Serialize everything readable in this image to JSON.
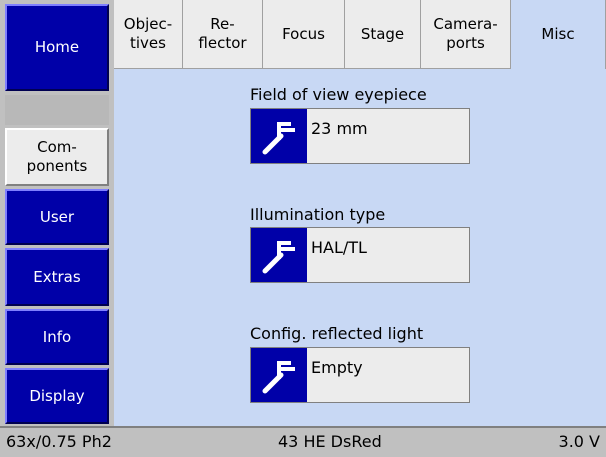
{
  "sidebar": {
    "items": [
      {
        "label": "Home"
      },
      {
        "line1": "Com-",
        "line2": "ponents"
      },
      {
        "label": "User"
      },
      {
        "label": "Extras"
      },
      {
        "label": "Info"
      },
      {
        "label": "Display"
      }
    ]
  },
  "tabs": [
    {
      "line1": "Objec-",
      "line2": "tives"
    },
    {
      "line1": "Re-",
      "line2": "flector"
    },
    {
      "line1": "Focus",
      "line2": ""
    },
    {
      "line1": "Stage",
      "line2": ""
    },
    {
      "line1": "Camera-",
      "line2": "ports"
    },
    {
      "line1": "Misc",
      "line2": ""
    }
  ],
  "misc": {
    "fov_label": "Field of view eyepiece",
    "fov_value": "23 mm",
    "illum_label": "Illumination type",
    "illum_value": "HAL/TL",
    "reflected_label": "Config. reflected light",
    "reflected_value": "Empty"
  },
  "status": {
    "objective": "63x/0.75 Ph2",
    "filter": "43 HE DsRed",
    "voltage": "3.0 V"
  },
  "colors": {
    "sidebar_button": "#0000a8",
    "panel_background": "#c8d8f4",
    "active_background": "#ececec"
  }
}
